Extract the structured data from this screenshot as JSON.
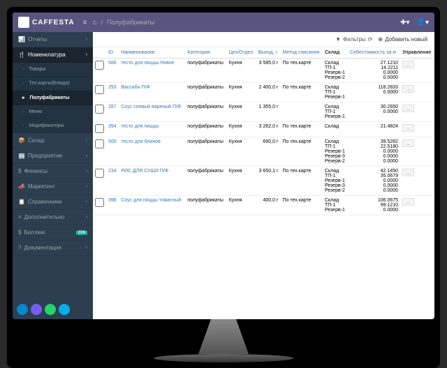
{
  "app_name": "CAFFESTA",
  "breadcrumb": "Полуфабрикаты",
  "sidebar": {
    "items": [
      {
        "icon": "📊",
        "label": "Отчеты",
        "type": "main"
      },
      {
        "icon": "🍴",
        "label": "Номенклатура",
        "type": "main",
        "active": true
      },
      {
        "label": "Товары",
        "type": "sub"
      },
      {
        "label": "Тех.карты(Блюда)",
        "type": "sub"
      },
      {
        "label": "Полуфабрикаты",
        "type": "sub",
        "selected": true
      },
      {
        "label": "Меню",
        "type": "sub"
      },
      {
        "label": "Модификаторы",
        "type": "sub"
      },
      {
        "icon": "📦",
        "label": "Склад",
        "type": "main"
      },
      {
        "icon": "🏢",
        "label": "Предприятие",
        "type": "main"
      },
      {
        "icon": "$",
        "label": "Финансы",
        "type": "main"
      },
      {
        "icon": "📣",
        "label": "Маркетинг",
        "type": "main"
      },
      {
        "icon": "📋",
        "label": "Справочники",
        "type": "main"
      },
      {
        "icon": "≡",
        "label": "Дополнительно",
        "type": "main"
      },
      {
        "icon": "$",
        "label": "Биллинг",
        "type": "main",
        "badge": "306"
      },
      {
        "icon": "?",
        "label": "Документация",
        "type": "main"
      }
    ]
  },
  "toolbar": {
    "filters": "Фильтры",
    "add": "Добавить новый"
  },
  "columns": [
    "",
    "ID",
    "Наименование",
    "Категория",
    "Цех/Отдел",
    "Выход, г",
    "Метод списания",
    "Склад",
    "Себестоимость за кг",
    "Управление"
  ],
  "rows": [
    {
      "id": "586",
      "name": "тесто для пиццы Новое",
      "cat": "полуфабрикаты",
      "dept": "Кухня",
      "out": "3 585,0 г",
      "method": "По тех.карте",
      "stocks": [
        "Склад",
        "ТП-1",
        "Резерв-1",
        "Резерв-2"
      ],
      "costs": [
        "27.1210",
        "14.2211",
        "0.0000",
        "0.0000"
      ]
    },
    {
      "id": "293",
      "name": "Вассаби П/Ф",
      "cat": "полуфабрикаты",
      "dept": "Кухня",
      "out": "2 400,0 г",
      "method": "По тех.карте",
      "stocks": [
        "Склад",
        "ТП-1",
        "Резерв-1"
      ],
      "costs": [
        "118.2833",
        "0.0000",
        ""
      ]
    },
    {
      "id": "287",
      "name": "Соус соевый вареный П/Ф",
      "cat": "полуфабрикаты",
      "dept": "Кухня",
      "out": "1 355,0 г",
      "method": "",
      "stocks": [
        "Склад",
        "ТП-1",
        "Резерв-1"
      ],
      "costs": [
        "30.2650",
        "0.0000",
        ""
      ]
    },
    {
      "id": "394",
      "name": "тесто для пиццы",
      "cat": "полуфабрикаты",
      "dept": "Кухня",
      "out": "3 262,0 г",
      "method": "По тех.карте",
      "stocks": [
        "Склад"
      ],
      "costs": [
        "21.4824"
      ]
    },
    {
      "id": "500",
      "name": "тесто для блинов",
      "cat": "полуфабрикаты",
      "dept": "Кухня",
      "out": "690,0 г",
      "method": "По тех.карте",
      "stocks": [
        "Склад",
        "ТП-1",
        "Резерв-1",
        "Резерв-3",
        "Резерв-2"
      ],
      "costs": [
        "39.5282",
        "22.5180",
        "0.0000",
        "0.0000",
        "0.0000"
      ]
    },
    {
      "id": "234",
      "name": "РИС ДЛЯ СУШИ П/Ф",
      "cat": "полуфабрикаты",
      "dept": "Кухня",
      "out": "3 650,1 г",
      "method": "По тех.карте",
      "stocks": [
        "Склад",
        "ТП-1",
        "Резерв-1",
        "Резерв-3",
        "Резерв-2"
      ],
      "costs": [
        "42.1450",
        "35.0679",
        "0.0000",
        "0.0000",
        "0.0000"
      ]
    },
    {
      "id": "398",
      "name": "Соус для пиццы томатный",
      "cat": "полуфабрикаты",
      "dept": "Кухня",
      "out": "400,0 г",
      "method": "По тех.карте",
      "stocks": [
        "Склад",
        "ТП-1",
        "Резерв-1"
      ],
      "costs": [
        "106.0675",
        "99.1210",
        "0.0000"
      ]
    }
  ]
}
